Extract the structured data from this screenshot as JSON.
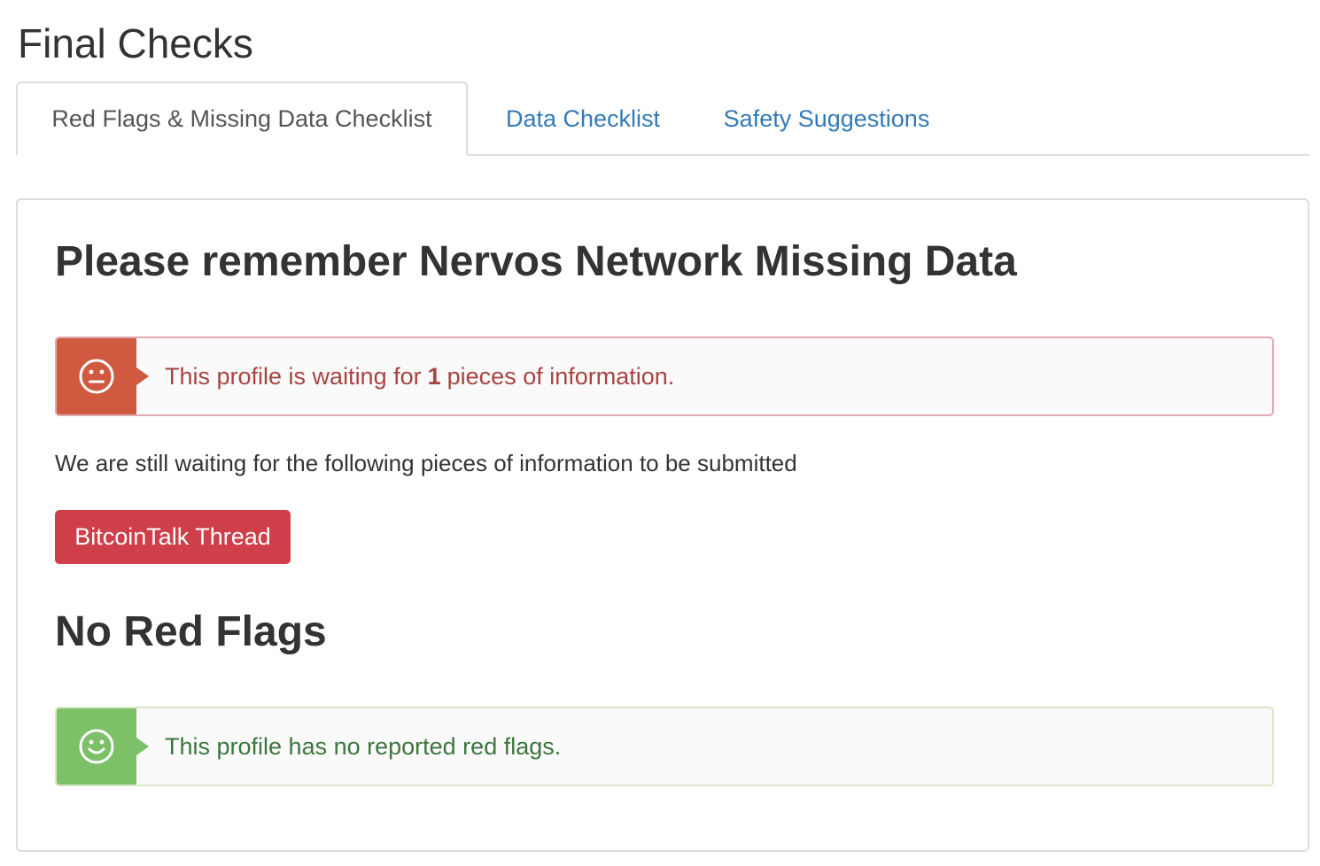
{
  "page": {
    "title": "Final Checks"
  },
  "tabs": [
    {
      "label": "Red Flags & Missing Data Checklist",
      "active": true
    },
    {
      "label": "Data Checklist",
      "active": false
    },
    {
      "label": "Safety Suggestions",
      "active": false
    }
  ],
  "missing_data": {
    "heading": "Please remember Nervos Network Missing Data",
    "alert": {
      "icon": "neutral-face-icon",
      "text_before": "This profile is waiting for",
      "count": "1",
      "text_after": "pieces of information."
    },
    "waiting_text": "We are still waiting for the following pieces of information to be submitted",
    "items": [
      "BitcoinTalk Thread"
    ]
  },
  "red_flags": {
    "heading": "No Red Flags",
    "alert": {
      "icon": "smile-face-icon",
      "text": "This profile has no reported red flags."
    }
  },
  "colors": {
    "link": "#337ab7",
    "danger_icon_bg": "#cf5a3f",
    "danger_text": "#a94442",
    "success_icon_bg": "#7cc068",
    "success_text": "#3c763d",
    "button_danger": "#cf3f49"
  }
}
